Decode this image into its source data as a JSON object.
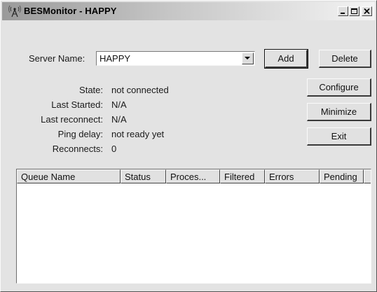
{
  "window": {
    "title": "BESMonitor - HAPPY",
    "app_icon": "antenna-icon",
    "controls": [
      "minimize-icon",
      "maximize-icon",
      "close-icon"
    ]
  },
  "server": {
    "label": "Server Name:",
    "value": "HAPPY"
  },
  "status": {
    "state_label": "State:",
    "state_value": "not connected",
    "last_started_label": "Last Started:",
    "last_started_value": "N/A",
    "last_reconnect_label": "Last reconnect:",
    "last_reconnect_value": "N/A",
    "ping_delay_label": "Ping delay:",
    "ping_delay_value": "not ready yet",
    "reconnects_label": "Reconnects:",
    "reconnects_value": "0"
  },
  "buttons": {
    "add": "Add",
    "delete": "Delete",
    "configure": "Configure",
    "minimize": "Minimize",
    "exit": "Exit"
  },
  "queue_table": {
    "columns": [
      "Queue Name",
      "Status",
      "Proces...",
      "Filtered",
      "Errors",
      "Pending"
    ],
    "rows": []
  }
}
